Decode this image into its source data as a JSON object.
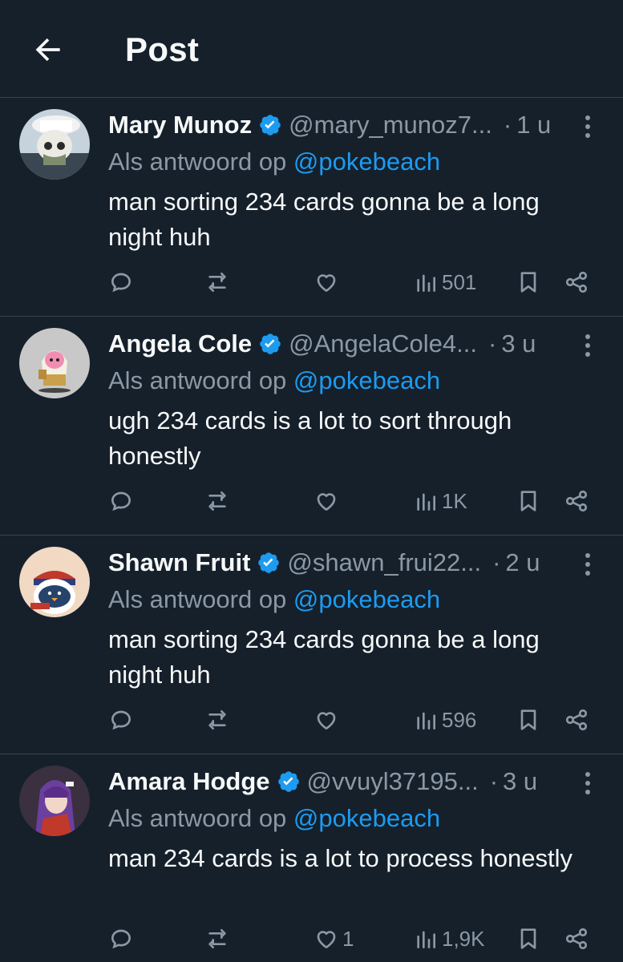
{
  "header": {
    "title": "Post"
  },
  "reply_prefix": "Als antwoord op ",
  "posts": [
    {
      "name": "Mary Munoz",
      "handle": "@mary_munoz7...",
      "time": "1 u",
      "mention": "@pokebeach",
      "text": "man sorting 234 cards gonna be a long night huh",
      "likes": "",
      "views": "501"
    },
    {
      "name": "Angela Cole",
      "handle": "@AngelaCole4...",
      "time": "3 u",
      "mention": "@pokebeach",
      "text": "ugh 234 cards is a lot to sort through honestly",
      "likes": "",
      "views": "1K"
    },
    {
      "name": "Shawn Fruit",
      "handle": "@shawn_frui22...",
      "time": "2 u",
      "mention": "@pokebeach",
      "text": "man sorting 234 cards gonna be a long night huh",
      "likes": "",
      "views": "596"
    },
    {
      "name": "Amara Hodge",
      "handle": "@vvuyl37195...",
      "time": "3 u",
      "mention": "@pokebeach",
      "text": "man 234 cards is a lot to process honestly",
      "likes": "1",
      "views": "1,9K"
    }
  ],
  "colors": {
    "background": "#15202b",
    "accent": "#1d9bf0",
    "muted": "#8b98a5",
    "divider": "#38444d"
  },
  "icons": [
    "back-arrow-icon",
    "verified-icon",
    "more-icon",
    "reply-icon",
    "repost-icon",
    "like-icon",
    "views-icon",
    "bookmark-icon",
    "share-icon"
  ]
}
